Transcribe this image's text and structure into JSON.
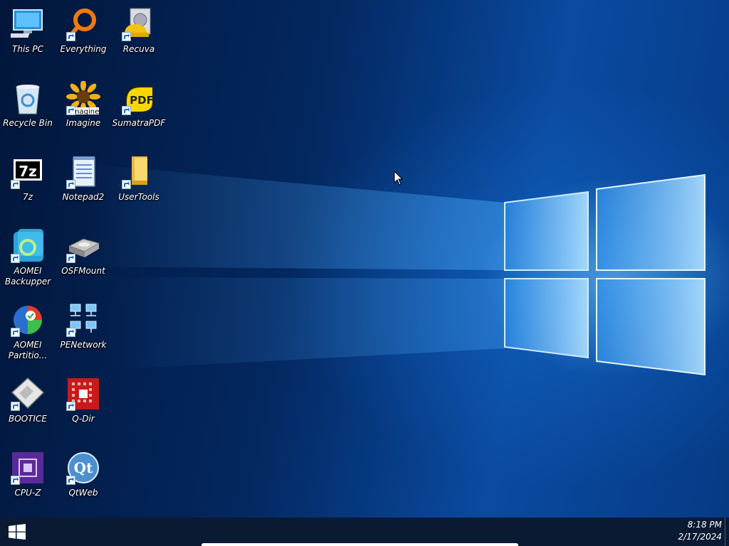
{
  "desktop": {
    "icons": [
      {
        "label": "This PC",
        "icon": "this-pc-icon"
      },
      {
        "label": "Everything",
        "icon": "everything-icon"
      },
      {
        "label": "Recuva",
        "icon": "recuva-icon"
      },
      {
        "label": "Recycle Bin",
        "icon": "recycle-bin-icon"
      },
      {
        "label": "Imagine",
        "icon": "imagine-icon"
      },
      {
        "label": "SumatraPDF",
        "icon": "sumatrapdf-icon"
      },
      {
        "label": "7z",
        "icon": "7z-icon"
      },
      {
        "label": "Notepad2",
        "icon": "notepad2-icon"
      },
      {
        "label": "UserTools",
        "icon": "folder-icon"
      },
      {
        "label": "AOMEI Backupper",
        "icon": "aomei-backupper-icon"
      },
      {
        "label": "OSFMount",
        "icon": "osfmount-icon"
      },
      {
        "label": "AOMEI Partitio...",
        "icon": "aomei-partition-icon"
      },
      {
        "label": "PENetwork",
        "icon": "penetwork-icon"
      },
      {
        "label": "BOOTICE",
        "icon": "bootice-icon"
      },
      {
        "label": "Q-Dir",
        "icon": "q-dir-icon"
      },
      {
        "label": "CPU-Z",
        "icon": "cpu-z-icon"
      },
      {
        "label": "QtWeb",
        "icon": "qtweb-icon"
      }
    ],
    "imagine_overlay_text": "Imagine",
    "sumatra_badge_text": "PDF",
    "sevenzip_badge_text": "7z",
    "qtweb_badge_text": "Qt"
  },
  "taskbar": {
    "start_icon": "windows-start-icon",
    "time": "8:18 PM",
    "date": "2/17/2024"
  },
  "colors": {
    "taskbar": "#0b1a33",
    "wallpaper_accent": "#0a4aa0"
  }
}
